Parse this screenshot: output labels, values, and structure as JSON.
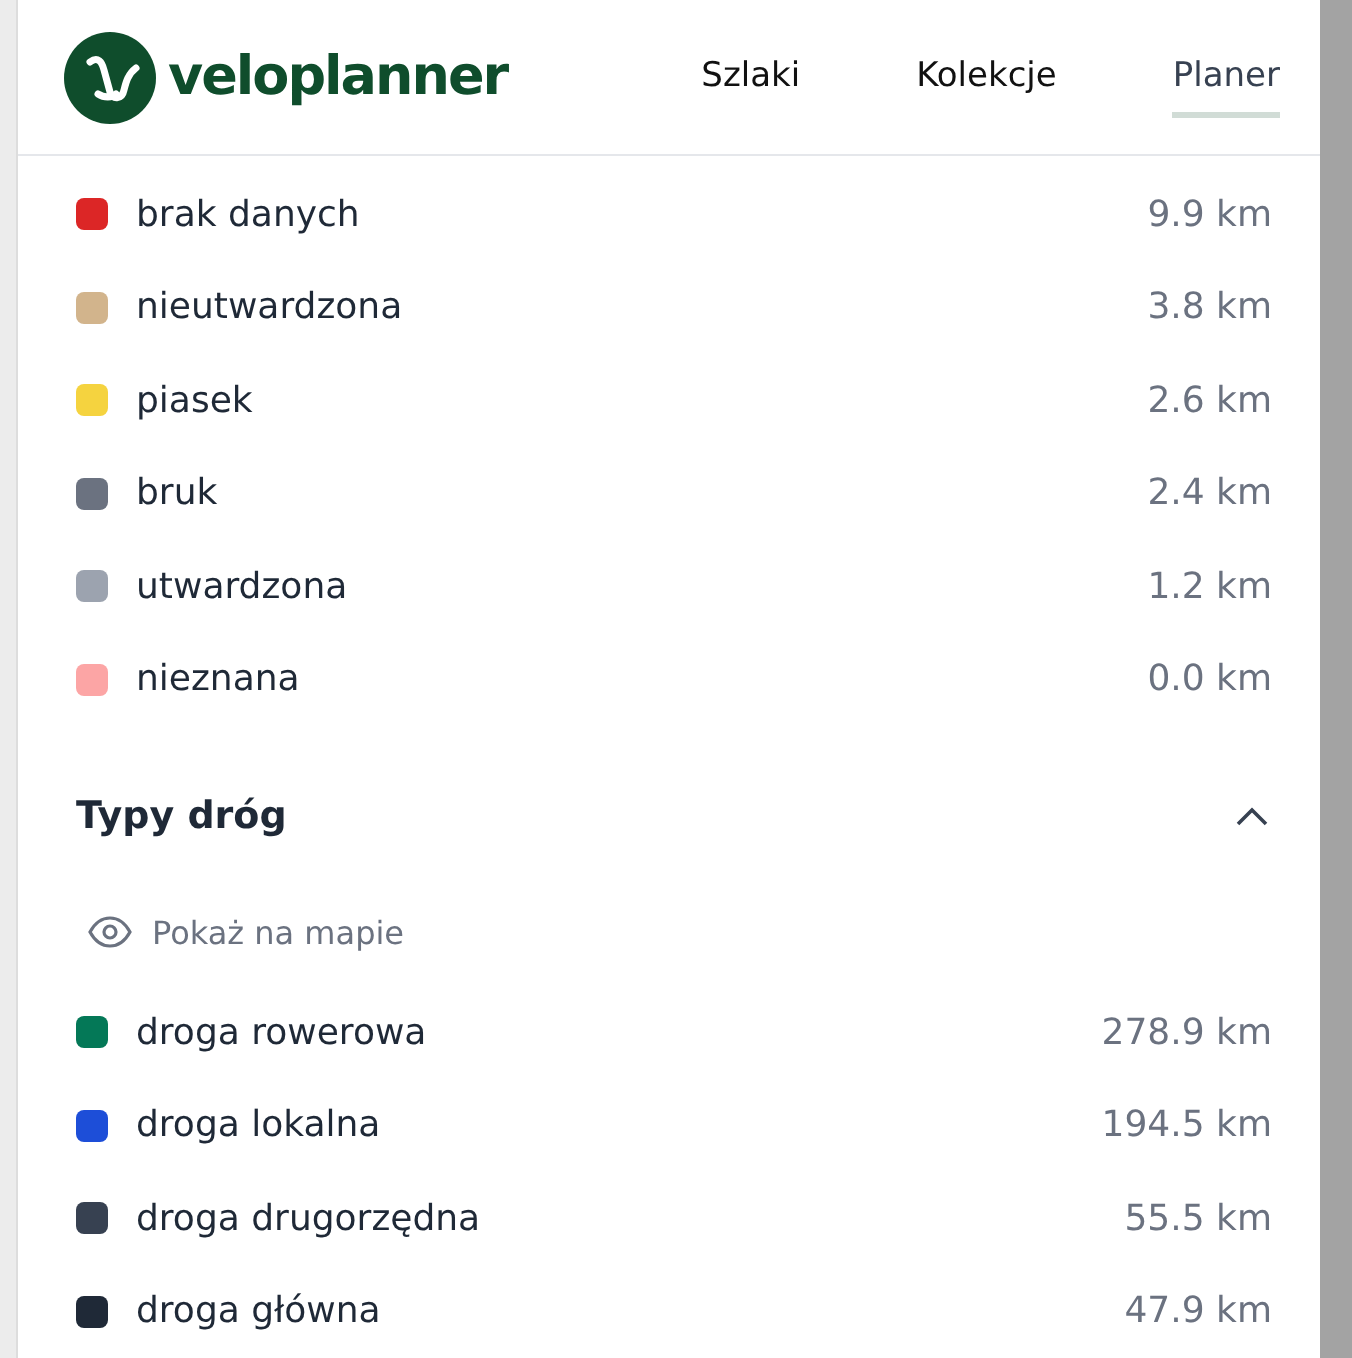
{
  "header": {
    "logo": "veloplanner",
    "nav": [
      {
        "label": "Szlaki",
        "selected": false
      },
      {
        "label": "Kolekcje",
        "selected": false
      },
      {
        "label": "Planer",
        "selected": true
      }
    ]
  },
  "surfaces": [
    {
      "name": "brak danych",
      "distance": "9.9 km",
      "color": "#dc2626"
    },
    {
      "name": "nieutwardzona",
      "distance": "3.8 km",
      "color": "#d2b48c"
    },
    {
      "name": "piasek",
      "distance": "2.6 km",
      "color": "#f5d33f"
    },
    {
      "name": "bruk",
      "distance": "2.4 km",
      "color": "#6b7280"
    },
    {
      "name": "utwardzona",
      "distance": "1.2 km",
      "color": "#9ca3af"
    },
    {
      "name": "nieznana",
      "distance": "0.0 km",
      "color": "#fca5a5"
    }
  ],
  "road_types": {
    "title": "Typy dróg",
    "expanded": true,
    "show_on_map": "Pokaż na mapie",
    "items": [
      {
        "name": "droga rowerowa",
        "distance": "278.9 km",
        "color": "#047857"
      },
      {
        "name": "droga lokalna",
        "distance": "194.5 km",
        "color": "#1d4ed8"
      },
      {
        "name": "droga drugorzędna",
        "distance": "55.5 km",
        "color": "#374151"
      },
      {
        "name": "droga główna",
        "distance": "47.9 km",
        "color": "#1f2937"
      }
    ]
  }
}
